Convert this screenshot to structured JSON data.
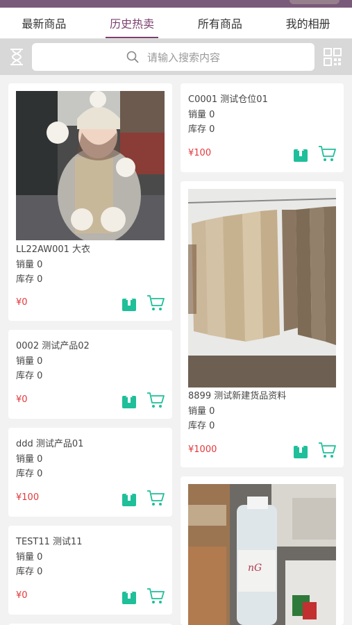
{
  "tabs": [
    "最新商品",
    "历史热卖",
    "所有商品",
    "我的相册"
  ],
  "active_tab": 1,
  "search": {
    "placeholder": "请输入搜索内容"
  },
  "colors": {
    "accent": "#7a3f6e",
    "price": "#e2383b",
    "action": "#1fbf9a"
  },
  "labels": {
    "sales": "销量",
    "stock": "库存",
    "currency": "¥"
  },
  "left_column": [
    {
      "title": "LL22AW001 大衣",
      "sales": "销量 0",
      "stock": "库存 0",
      "price": "¥0",
      "image": "woman-in-knit-hat-photo"
    },
    {
      "title": "0002 测试产品02",
      "sales": "销量 0",
      "stock": "库存 0",
      "price": "¥0"
    },
    {
      "title": "ddd 测试产品01",
      "sales": "销量 0",
      "stock": "库存 0",
      "price": "¥100"
    },
    {
      "title": "TEST11 测试11",
      "sales": "销量 0",
      "stock": "库存 0",
      "price": "¥0"
    }
  ],
  "right_column": [
    {
      "title": "C0001 测试仓位01",
      "sales": "销量 0",
      "stock": "库存 0",
      "price": "¥100"
    },
    {
      "title": "8899 测试新建货品资料",
      "sales": "销量 0",
      "stock": "库存 0",
      "price": "¥1000",
      "image": "sweaters-on-rack-photo"
    },
    {
      "title": "",
      "image": "water-bottle-photo"
    }
  ]
}
